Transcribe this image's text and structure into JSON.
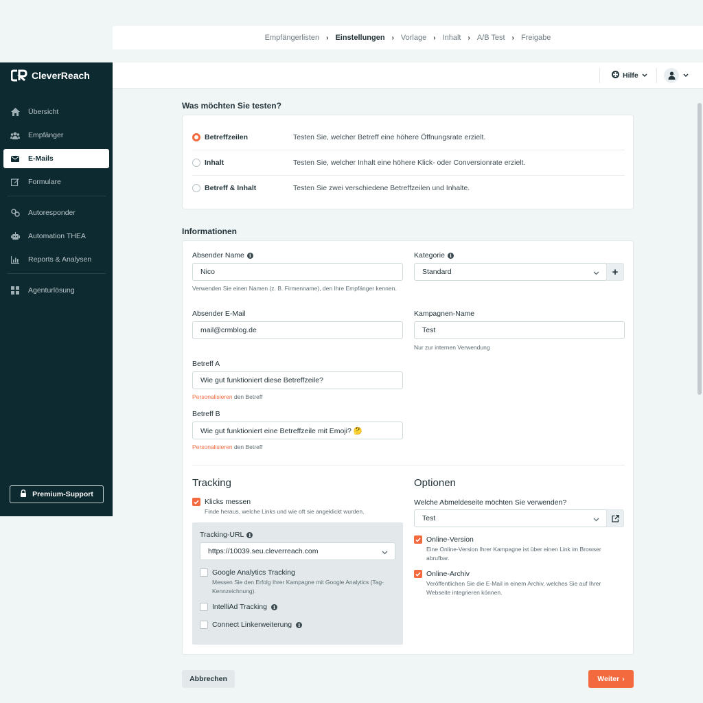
{
  "breadcrumb": {
    "items": [
      "Empfängerlisten",
      "Einstellungen",
      "Vorlage",
      "Inhalt",
      "A/B Test",
      "Freigabe"
    ],
    "active": "Einstellungen"
  },
  "sidebar": {
    "logo": "CleverReach",
    "items": [
      {
        "label": "Übersicht",
        "icon": "home-icon"
      },
      {
        "label": "Empfänger",
        "icon": "users-icon"
      },
      {
        "label": "E-Mails",
        "icon": "envelope-icon",
        "active": true
      },
      {
        "label": "Formulare",
        "icon": "edit-icon"
      },
      {
        "label": "Autoresponder",
        "icon": "autoresponder-icon"
      },
      {
        "label": "Automation THEA",
        "icon": "robot-icon"
      },
      {
        "label": "Reports & Analysen",
        "icon": "chart-icon"
      },
      {
        "label": "Agenturlösung",
        "icon": "grid-icon"
      }
    ],
    "premium": "Premium-Support"
  },
  "topbar": {
    "help": "Hilfe"
  },
  "test_section": {
    "title": "Was möchten Sie testen?",
    "options": [
      {
        "label": "Betreffzeilen",
        "desc": "Testen Sie, welcher Betreff eine höhere Öffnungsrate erzielt.",
        "checked": true
      },
      {
        "label": "Inhalt",
        "desc": "Testen Sie, welcher Inhalt eine höhere Klick- oder Conversionrate erzielt.",
        "checked": false
      },
      {
        "label": "Betreff & Inhalt",
        "desc": "Testen Sie zwei verschiedene Betreffzeilen und Inhalte.",
        "checked": false
      }
    ]
  },
  "info": {
    "title": "Informationen",
    "sender_name_label": "Absender Name",
    "sender_name_value": "Nico",
    "sender_name_help": "Verwenden Sie einen Namen (z. B. Firmenname), den Ihre Empfänger kennen.",
    "category_label": "Kategorie",
    "category_value": "Standard",
    "sender_email_label": "Absender E-Mail",
    "sender_email_value": "mail@crmblog.de",
    "campaign_label": "Kampagnen-Name",
    "campaign_value": "Test",
    "campaign_help": "Nur zur internen Verwendung",
    "subject_a_label": "Betreff A",
    "subject_a_value": "Wie gut funktioniert diese Betreffzeile?",
    "subject_b_label": "Betreff B",
    "subject_b_value": "Wie gut funktioniert eine Betreffzeile mit Emoji? 🤔",
    "personalize_link": "Personalisieren",
    "personalize_rest": " den Betreff"
  },
  "tracking": {
    "title": "Tracking",
    "clicks_label": "Klicks messen",
    "clicks_help": "Finde heraus, welche Links und wie oft sie angeklickt wurden.",
    "url_label": "Tracking-URL",
    "url_value": "https://10039.seu.cleverreach.com",
    "ga_label": "Google Analytics Tracking",
    "ga_help": "Messen Sie den Erfolg Ihrer Kampagne mit Google Analytics (Tag-Kennzeichnung).",
    "intelliad_label": "IntelliAd Tracking",
    "linker_label": "Connect Linkerweiterung"
  },
  "options": {
    "title": "Optionen",
    "unsubscribe_label": "Welche Abmeldeseite möchten Sie verwenden?",
    "unsubscribe_value": "Test",
    "online_version_label": "Online-Version",
    "online_version_help": "Eine Online-Version Ihrer Kampagne ist über einen Link im Browser abrufbar.",
    "online_archive_label": "Online-Archiv",
    "online_archive_help": "Veröffentlichen Sie die E-Mail in einem Archiv, welches Sie auf Ihrer Webseite integrieren können."
  },
  "footer": {
    "cancel": "Abbrechen",
    "next": "Weiter"
  },
  "colors": {
    "accent": "#f26a3d",
    "sidebar_bg": "#0e2a31",
    "page_bg": "#f0f5f6"
  }
}
